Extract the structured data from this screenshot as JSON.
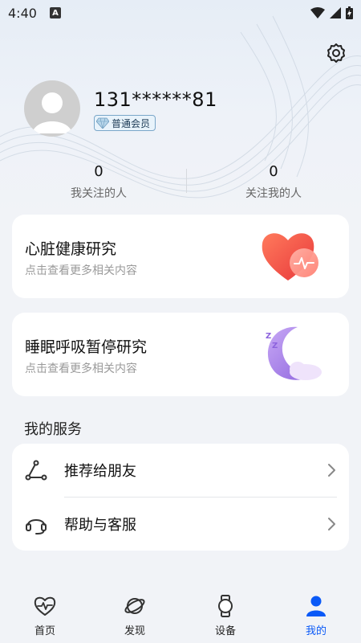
{
  "status_bar": {
    "time": "4:40",
    "indicator": "A",
    "icons": [
      "wifi-icon",
      "signal-icon",
      "battery-charging-icon"
    ]
  },
  "profile": {
    "username": "131******81",
    "member_label": "普通会员",
    "settings_icon": "gear-icon"
  },
  "follow": [
    {
      "count": "0",
      "label": "我关注的人"
    },
    {
      "count": "0",
      "label": "关注我的人"
    }
  ],
  "research_cards": [
    {
      "title": "心脏健康研究",
      "subtitle": "点击查看更多相关内容",
      "icon": "heart-ecg-icon"
    },
    {
      "title": "睡眠呼吸暂停研究",
      "subtitle": "点击查看更多相关内容",
      "icon": "moon-sleep-icon"
    }
  ],
  "services": {
    "section_title": "我的服务",
    "items": [
      {
        "label": "推荐给朋友",
        "icon": "share-icon"
      },
      {
        "label": "帮助与客服",
        "icon": "headset-icon"
      }
    ]
  },
  "bottom_nav": [
    {
      "label": "首页",
      "icon": "heart-pulse-icon",
      "active": false
    },
    {
      "label": "发现",
      "icon": "planet-icon",
      "active": false
    },
    {
      "label": "设备",
      "icon": "watch-icon",
      "active": false
    },
    {
      "label": "我的",
      "icon": "person-icon",
      "active": true
    }
  ],
  "colors": {
    "accent": "#0a59f7",
    "background": "#f1f3f7",
    "card": "#ffffff",
    "heart": "#f0534a",
    "moon": "#a78be8"
  }
}
